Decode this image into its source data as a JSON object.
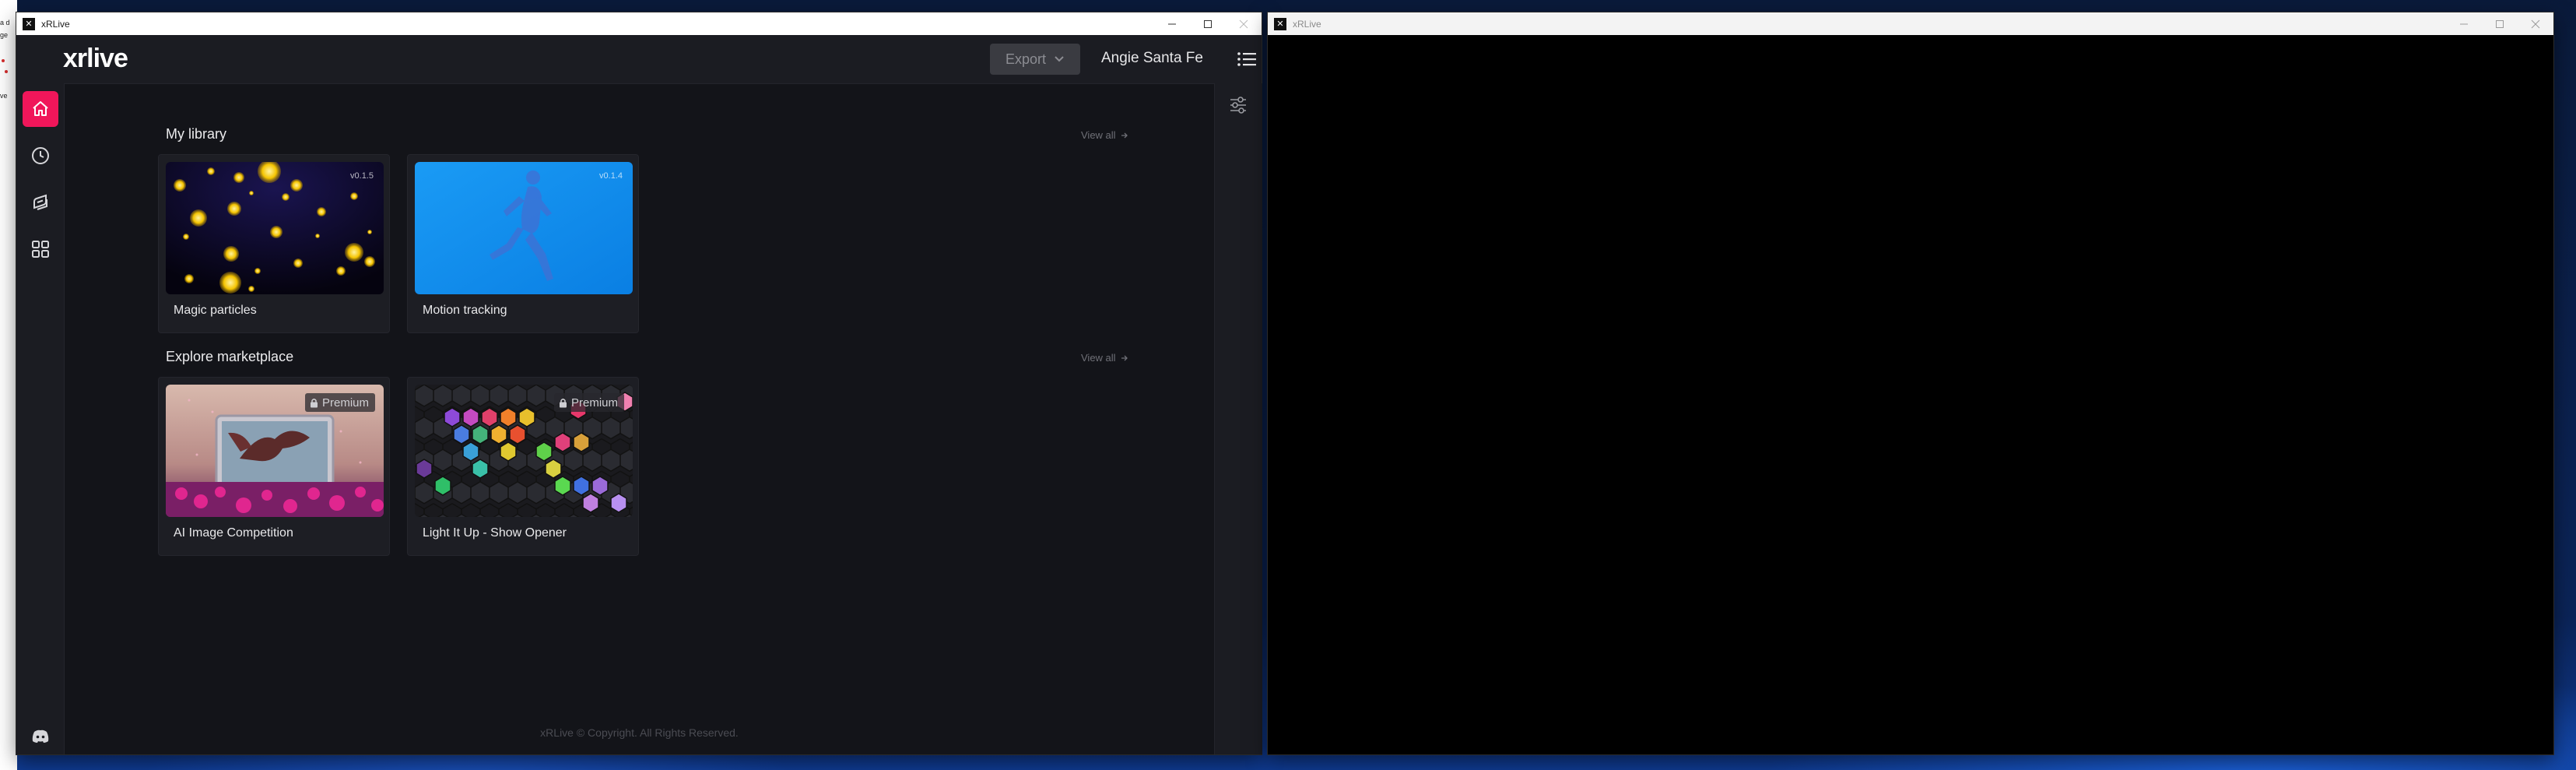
{
  "desktop": {
    "edge_fragments": [
      "a d",
      "ge",
      "ve"
    ]
  },
  "main_window": {
    "title": "xRLive",
    "controls": {
      "minimize": "minimize-icon",
      "maximize": "maximize-icon",
      "close": "close-icon"
    }
  },
  "second_window": {
    "title": "xRLive"
  },
  "header": {
    "logo": "xrlive",
    "export_label": "Export",
    "user_name": "Angie Santa Fe"
  },
  "sidebar": {
    "items": [
      {
        "name": "home",
        "icon": "home-icon",
        "active": true
      },
      {
        "name": "history",
        "icon": "clock-icon",
        "active": false
      },
      {
        "name": "marketplace",
        "icon": "layers-icon",
        "active": false
      },
      {
        "name": "apps",
        "icon": "grid-icon",
        "active": false
      }
    ],
    "bottom_icon": "discord-icon"
  },
  "library": {
    "title": "My library",
    "view_all": "View all",
    "cards": [
      {
        "label": "Magic particles",
        "version": "v0.1.5"
      },
      {
        "label": "Motion tracking",
        "version": "v0.1.4"
      }
    ]
  },
  "marketplace": {
    "title": "Explore marketplace",
    "view_all": "View all",
    "cards": [
      {
        "label": "AI Image Competition",
        "badge": "Premium"
      },
      {
        "label": "Light It Up - Show Opener",
        "badge": "Premium"
      }
    ]
  },
  "footer": {
    "text": "xRLive © Copyright. All Rights Reserved."
  },
  "colors": {
    "accent": "#f0165a",
    "app_background": "#131419",
    "panel": "#1b1c22"
  }
}
